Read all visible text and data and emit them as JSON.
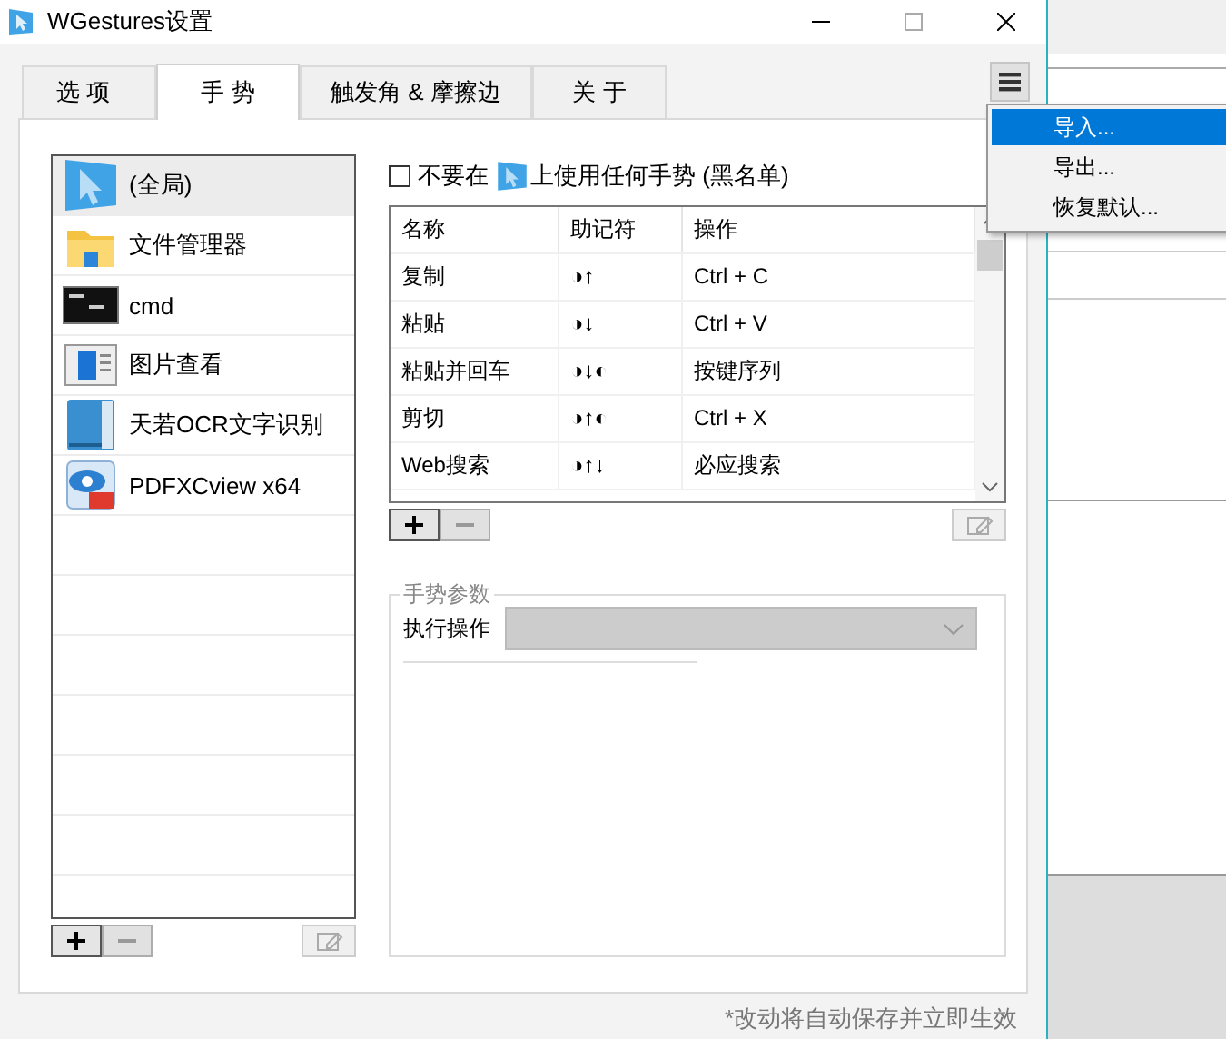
{
  "window": {
    "title": "WGestures设置"
  },
  "tabs": [
    {
      "label": "选 项",
      "selected": false
    },
    {
      "label": "手 势",
      "selected": true
    },
    {
      "label": "触发角 & 摩擦边",
      "selected": false
    },
    {
      "label": "关 于",
      "selected": false
    }
  ],
  "apps": [
    {
      "name": "(全局)",
      "kind": "global",
      "selected": true
    },
    {
      "name": "文件管理器",
      "kind": "folder",
      "selected": false
    },
    {
      "name": "cmd",
      "kind": "terminal",
      "selected": false
    },
    {
      "name": "图片查看",
      "kind": "viewer",
      "selected": false
    },
    {
      "name": "天若OCR文字识别",
      "kind": "book",
      "selected": false
    },
    {
      "name": "PDFXCview x64",
      "kind": "pdf",
      "selected": false
    }
  ],
  "blacklist": {
    "checked": false,
    "before": "不要在",
    "after": "上使用任何手势 (黑名单)"
  },
  "gestures": {
    "columns": [
      "名称",
      "助记符",
      "操作"
    ],
    "rows": [
      {
        "name": "复制",
        "mnemonic": "◑↑",
        "action": "Ctrl + C"
      },
      {
        "name": "粘贴",
        "mnemonic": "◑↓",
        "action": "Ctrl + V"
      },
      {
        "name": "粘贴并回车",
        "mnemonic": "◑↓◐",
        "action": "按键序列"
      },
      {
        "name": "剪切",
        "mnemonic": "◑↑◐",
        "action": "Ctrl + X"
      },
      {
        "name": "Web搜索",
        "mnemonic": "◑↑↓",
        "action": "必应搜索"
      }
    ]
  },
  "params": {
    "legend": "手势参数",
    "label": "执行操作",
    "disabled": true
  },
  "footer": "*改动将自动保存并立即生效",
  "menu": {
    "items": [
      {
        "label": "导入...",
        "selected": true
      },
      {
        "label": "导出...",
        "selected": false
      },
      {
        "label": "恢复默认...",
        "selected": false
      }
    ]
  }
}
